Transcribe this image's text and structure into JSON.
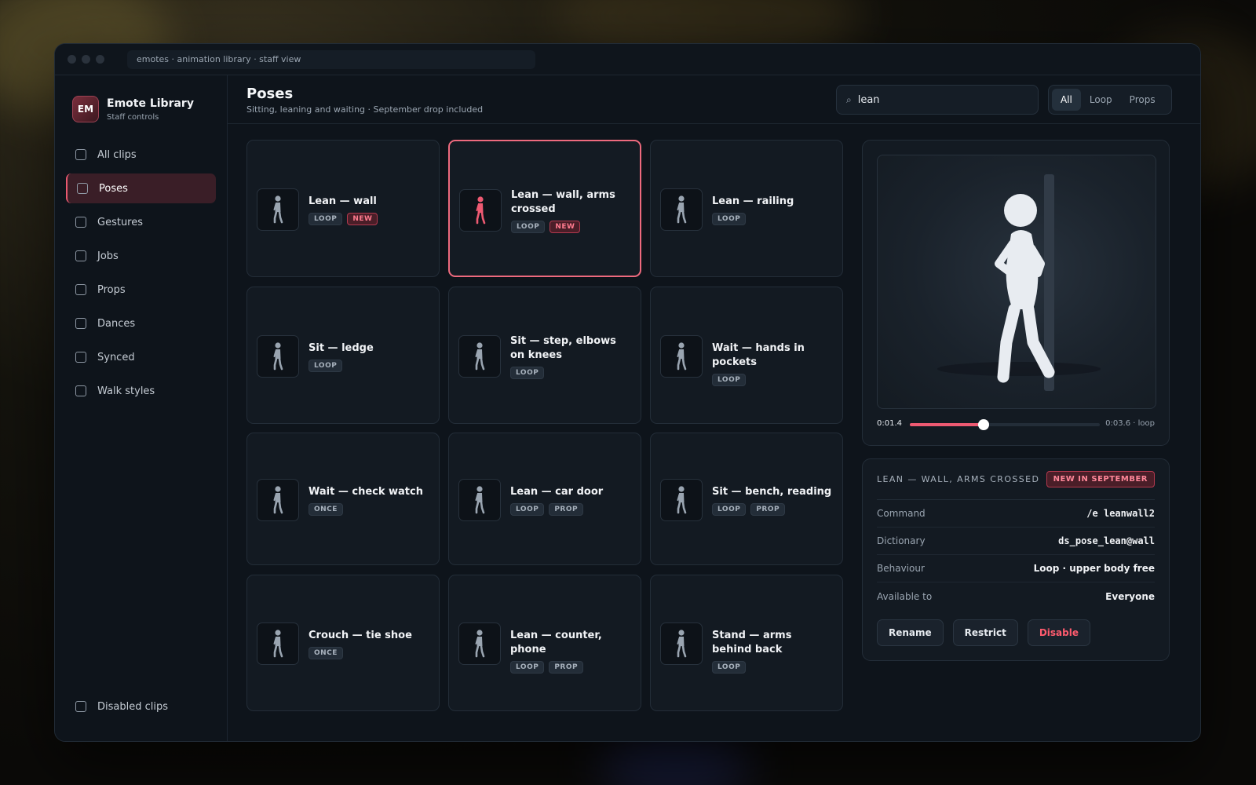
{
  "window": {
    "url": "emotes · animation library · staff view"
  },
  "brand": {
    "initials": "EM",
    "title": "Emote Library",
    "subtitle": "Staff controls"
  },
  "sidebar": {
    "items": [
      {
        "label": "All clips",
        "active": false
      },
      {
        "label": "Poses",
        "active": true
      },
      {
        "label": "Gestures",
        "active": false
      },
      {
        "label": "Jobs",
        "active": false
      },
      {
        "label": "Props",
        "active": false
      },
      {
        "label": "Dances",
        "active": false
      },
      {
        "label": "Synced",
        "active": false
      },
      {
        "label": "Walk styles",
        "active": false
      }
    ],
    "bottom_item": "Disabled clips"
  },
  "header": {
    "title": "Poses",
    "subtitle": "Sitting, leaning and waiting · September drop included",
    "search_value": "lean",
    "search_icon": "search-icon",
    "filters": [
      {
        "label": "All",
        "selected": true
      },
      {
        "label": "Loop",
        "selected": false
      },
      {
        "label": "Props",
        "selected": false
      }
    ]
  },
  "clips": [
    {
      "title": "Lean — wall",
      "tags": [
        "LOOP",
        "NEW"
      ],
      "selected": false
    },
    {
      "title": "Lean — wall, arms crossed",
      "tags": [
        "LOOP",
        "NEW"
      ],
      "selected": true
    },
    {
      "title": "Lean — railing",
      "tags": [
        "LOOP"
      ],
      "selected": false
    },
    {
      "title": "Sit — ledge",
      "tags": [
        "LOOP"
      ],
      "selected": false
    },
    {
      "title": "Sit — step, elbows on knees",
      "tags": [
        "LOOP"
      ],
      "selected": false
    },
    {
      "title": "Wait — hands in pockets",
      "tags": [
        "LOOP"
      ],
      "selected": false
    },
    {
      "title": "Wait — check watch",
      "tags": [
        "ONCE"
      ],
      "selected": false
    },
    {
      "title": "Lean — car door",
      "tags": [
        "LOOP",
        "PROP"
      ],
      "selected": false
    },
    {
      "title": "Sit — bench, reading",
      "tags": [
        "LOOP",
        "PROP"
      ],
      "selected": false
    },
    {
      "title": "Crouch — tie shoe",
      "tags": [
        "ONCE"
      ],
      "selected": false
    },
    {
      "title": "Lean — counter, phone",
      "tags": [
        "LOOP",
        "PROP"
      ],
      "selected": false
    },
    {
      "title": "Stand — arms behind back",
      "tags": [
        "LOOP"
      ],
      "selected": false
    }
  ],
  "preview": {
    "time_current": "0:01.4",
    "time_total": "0:03.6 · loop",
    "progress": 0.389
  },
  "details": {
    "title": "LEAN — WALL, ARMS CROSSED",
    "badge": "NEW IN SEPTEMBER",
    "rows": [
      {
        "key": "Command",
        "value": "/e leanwall2"
      },
      {
        "key": "Dictionary",
        "value": "ds_pose_lean@wall"
      },
      {
        "key": "Behaviour",
        "value": "Loop · upper body free"
      },
      {
        "key": "Available to",
        "value": "Everyone"
      }
    ],
    "actions": [
      "Rename",
      "Restrict",
      "Disable"
    ]
  },
  "colors": {
    "accent": "#ee5a72",
    "figure_default": "#9aa5b1",
    "figure_selected": "#ee5a72"
  }
}
